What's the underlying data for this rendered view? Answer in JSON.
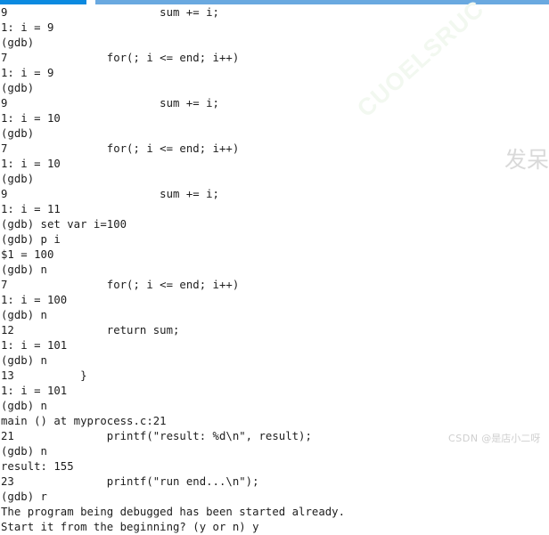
{
  "window": {
    "top_strip": {
      "active_tab_color": "#0b8ae0",
      "inactive_bar_color": "#6aa9e0"
    }
  },
  "terminal": {
    "prompt": "(gdb)",
    "font_color": "#1d1d1d",
    "background": "#ffffff",
    "lines": [
      "9\t\t\tsum += i;",
      "1: i = 9",
      "(gdb) ",
      "7\t\tfor(; i <= end; i++)",
      "1: i = 9",
      "(gdb) ",
      "9\t\t\tsum += i;",
      "1: i = 10",
      "(gdb) ",
      "7\t\tfor(; i <= end; i++)",
      "1: i = 10",
      "(gdb) ",
      "9\t\t\tsum += i;",
      "1: i = 11",
      "(gdb) set var i=100",
      "(gdb) p i",
      "$1 = 100",
      "(gdb) n",
      "7\t\tfor(; i <= end; i++)",
      "1: i = 100",
      "(gdb) n",
      "12\t\treturn sum;",
      "1: i = 101",
      "(gdb) n",
      "13\t    }",
      "1: i = 101",
      "(gdb) n",
      "main () at myprocess.c:21",
      "21\t\tprintf(\"result: %d\\n\", result);",
      "(gdb) n",
      "result: 155",
      "23\t\tprintf(\"run end...\\n\");",
      "(gdb) r",
      "The program being debugged has been started already.",
      "Start it from the beginning? (y or n) y"
    ]
  },
  "watermarks": {
    "diagonal_text": "CUOELSRUC",
    "cjk_text": "发呆",
    "csdn_brand": "CSDN",
    "csdn_handle": "@是店小二呀"
  }
}
